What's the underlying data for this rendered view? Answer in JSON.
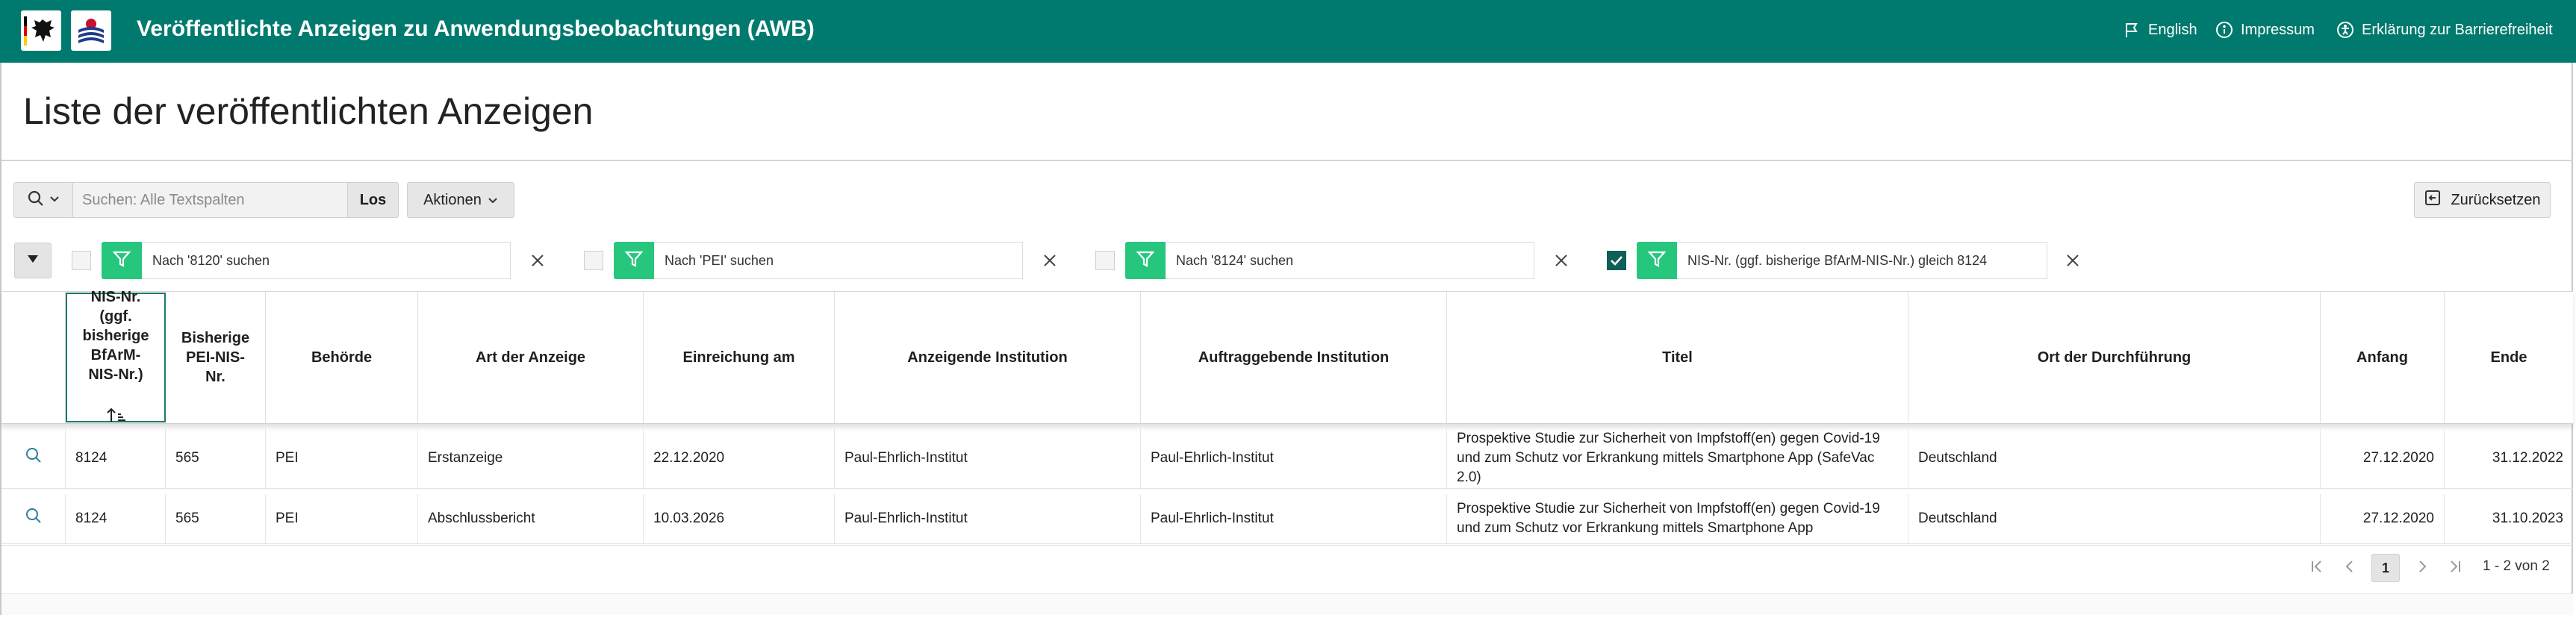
{
  "header": {
    "title": "Veröffentlichte Anzeigen zu Anwendungsbeobachtungen (AWB)",
    "links": {
      "english": "English",
      "impressum": "Impressum",
      "accessibility": "Erklärung zur Barrierefreiheit"
    },
    "logos": [
      "bundesadler-logo",
      "bfarm-logo"
    ]
  },
  "page": {
    "title": "Liste der veröffentlichten Anzeigen"
  },
  "toolbar": {
    "search_placeholder": "Suchen: Alle Textspalten",
    "go_label": "Los",
    "actions_label": "Aktionen",
    "reset_label": "Zurücksetzen"
  },
  "filters": [
    {
      "label": "Nach '8120' suchen",
      "checked": false
    },
    {
      "label": "Nach 'PEI' suchen",
      "checked": false
    },
    {
      "label": "Nach '8124' suchen",
      "checked": false
    },
    {
      "label": "NIS-Nr. (ggf. bisherige BfArM-NIS-Nr.) gleich 8124",
      "checked": true
    }
  ],
  "table": {
    "columns": [
      "NIS-Nr.\n(ggf.\nbisherige\nBfArM-\nNIS-Nr.)",
      "Bisherige\nPEI-NIS-\nNr.",
      "Behörde",
      "Art der Anzeige",
      "Einreichung am",
      "Anzeigende Institution",
      "Auftraggebende Institution",
      "Titel",
      "Ort der Durchführung",
      "Anfang",
      "Ende"
    ],
    "rows": [
      {
        "cells": [
          "8124",
          "565",
          "PEI",
          "Erstanzeige",
          "22.12.2020",
          "Paul-Ehrlich-Institut",
          "Paul-Ehrlich-Institut",
          "Prospektive Studie zur Sicherheit von Impfstoff(en) gegen Covid-19 und zum Schutz vor Erkrankung mittels Smartphone App (SafeVac 2.0)",
          "Deutschland",
          "27.12.2020",
          "31.12.2022"
        ]
      },
      {
        "cells": [
          "8124",
          "565",
          "PEI",
          "Abschlussbericht",
          "10.03.2026",
          "Paul-Ehrlich-Institut",
          "Paul-Ehrlich-Institut",
          "Prospektive Studie zur Sicherheit von Impfstoff(en) gegen Covid-19 und zum Schutz vor Erkrankung mittels Smartphone App",
          "Deutschland",
          "27.12.2020",
          "31.10.2023"
        ]
      }
    ]
  },
  "pagination": {
    "current_page": "1",
    "info": "1 - 2 von 2"
  },
  "colors": {
    "header": "#007a6e",
    "filter_button": "#26c77c",
    "checked": "#0f5e57"
  }
}
